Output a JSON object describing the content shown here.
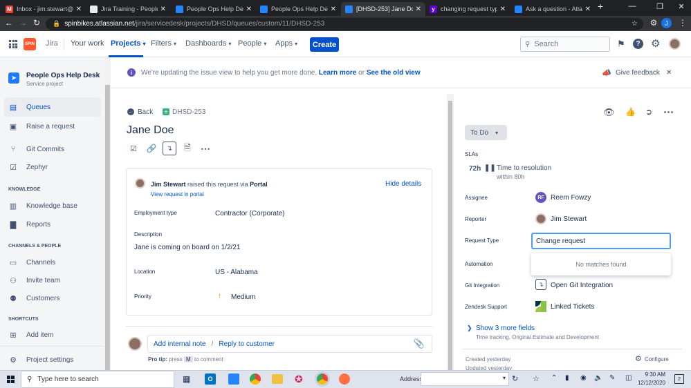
{
  "browser": {
    "tabs": [
      {
        "title": "Inbox - jim.stewart@sp",
        "icon": "gmail-icon",
        "color": "#ea4335",
        "glyph": "M"
      },
      {
        "title": "Jira Training - People C",
        "icon": "doc-icon",
        "color": "#e8eaed",
        "glyph": ""
      },
      {
        "title": "People Ops Help Desk",
        "icon": "jira-icon",
        "color": "#2684ff",
        "glyph": ""
      },
      {
        "title": "People Ops Help Desk",
        "icon": "jira-icon",
        "color": "#2684ff",
        "glyph": ""
      },
      {
        "title": "[DHSD-253] Jane Doe",
        "icon": "jira-icon",
        "color": "#2684ff",
        "glyph": ""
      },
      {
        "title": "changing request type",
        "icon": "yahoo-icon",
        "color": "#6001d2",
        "glyph": "y"
      },
      {
        "title": "Ask a question - Atlass",
        "icon": "atlassian-icon",
        "color": "#2684ff",
        "glyph": ""
      }
    ],
    "new_tab": "+",
    "url_host": "spinbikes.atlassian.net",
    "url_path": "/jira/servicedesk/projects/DHSD/queues/custom/11/DHSD-253",
    "profile_initial": "J"
  },
  "topnav": {
    "product": "Jira",
    "items": [
      "Your work",
      "Projects",
      "Filters",
      "Dashboards",
      "People",
      "Apps"
    ],
    "create": "Create",
    "search_placeholder": "Search"
  },
  "sidebar": {
    "project_name": "People Ops Help Desk",
    "project_type": "Service project",
    "items_top": [
      {
        "label": "Queues",
        "icon": "queues-icon"
      },
      {
        "label": "Raise a request",
        "icon": "raise-request-icon"
      },
      {
        "label": "Git Commits",
        "icon": "git-commits-icon"
      },
      {
        "label": "Zephyr",
        "icon": "zephyr-icon"
      }
    ],
    "knowledge_heading": "KNOWLEDGE",
    "knowledge_items": [
      {
        "label": "Knowledge base",
        "icon": "knowledge-base-icon"
      },
      {
        "label": "Reports",
        "icon": "reports-icon"
      }
    ],
    "channels_heading": "CHANNELS & PEOPLE",
    "channels_items": [
      {
        "label": "Channels",
        "icon": "channels-icon"
      },
      {
        "label": "Invite team",
        "icon": "invite-team-icon"
      },
      {
        "label": "Customers",
        "icon": "customers-icon"
      }
    ],
    "shortcuts_heading": "SHORTCUTS",
    "shortcuts_items": [
      {
        "label": "Add item",
        "icon": "add-item-icon"
      }
    ],
    "settings": "Project settings"
  },
  "banner": {
    "text": "We're updating the issue view to help you get more done.",
    "learn_more": "Learn more",
    "or": "or",
    "see_old": "See the old view",
    "feedback": "Give feedback"
  },
  "issue": {
    "back": "Back",
    "key": "DHSD-253",
    "title": "Jane Doe",
    "reporter_name": "Jim Stewart",
    "raised_text": "raised this request via",
    "channel": "Portal",
    "view_portal": "View request in portal",
    "hide_details": "Hide details",
    "fields": [
      {
        "label": "Employment type",
        "value": "Contractor (Corporate)"
      },
      {
        "label": "Description",
        "value": "Jane is coming on board on 1/2/21"
      },
      {
        "label": "Location",
        "value": "US - Alabama"
      },
      {
        "label": "Priority",
        "value": "Medium"
      }
    ],
    "add_note": "Add internal note",
    "separator": "/",
    "reply": "Reply to customer",
    "pro_tip_label": "Pro tip:",
    "pro_tip_press": "press",
    "pro_tip_key": "M",
    "pro_tip_rest": "to comment"
  },
  "details": {
    "status": "To Do",
    "slas_heading": "SLAs",
    "sla_time": "72h",
    "sla_name": "Time to resolution",
    "sla_within": "within 80h",
    "assignee_label": "Assignee",
    "assignee_initials": "RF",
    "assignee": "Reem Fowzy",
    "reporter_label": "Reporter",
    "reporter": "Jim Stewart",
    "request_type_label": "Request Type",
    "request_type_value": "Change request",
    "no_matches": "No matches found",
    "automation_label": "Automation",
    "git_label": "Git Integration",
    "git_open": "Open",
    "git_name": "Git Integration",
    "zendesk_label": "Zendesk Support",
    "zendesk_value": "Linked Tickets",
    "show_more": "Show 3 more fields",
    "show_more_sub": "Time tracking, Original Estimate and Development",
    "created": "Created yesterday",
    "updated": "Updated yesterday",
    "configure": "Configure"
  },
  "taskbar": {
    "search_placeholder": "Type here to search",
    "address_label": "Address",
    "time": "9:30 AM",
    "date": "12/12/2020",
    "notif_count": "2"
  },
  "colors": {
    "jira_blue": "#0052cc",
    "link_blue": "#0052cc",
    "status_grey": "#dfe1e6",
    "assignee_avatar": "#6554c0"
  }
}
